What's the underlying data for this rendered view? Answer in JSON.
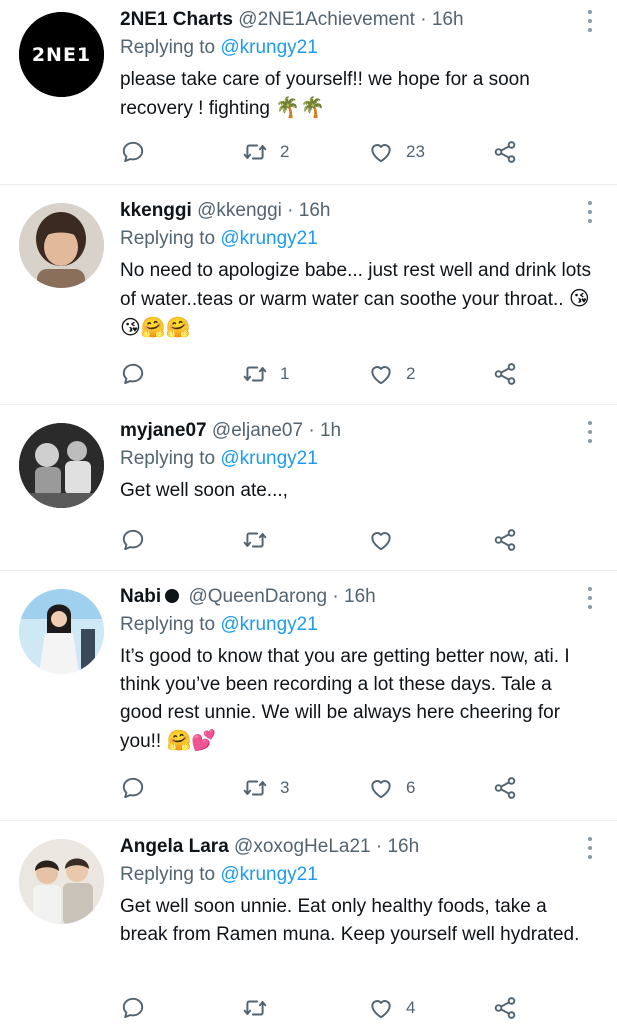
{
  "tweets": [
    {
      "name": "2NE1 Charts",
      "handle": "@2NE1Achievement",
      "time": "16h",
      "replying_label": "Replying to",
      "replying_to": "@krungy21",
      "text": "please take care of yourself!! we hope for a soon recovery ! fighting",
      "emoji": "🌴🌴",
      "retweets": "2",
      "likes": "23",
      "avatar_text": "2NE1"
    },
    {
      "name": "kkenggi",
      "handle": "@kkenggi",
      "time": "16h",
      "replying_label": "Replying to",
      "replying_to": "@krungy21",
      "text": "No need to apologize babe... just rest well and drink lots of water..teas or warm water can soothe your throat..",
      "emoji": "😘😘🤗🤗",
      "retweets": "1",
      "likes": "2"
    },
    {
      "name": "myjane07",
      "handle": "@eljane07",
      "time": "1h",
      "replying_label": "Replying to",
      "replying_to": "@krungy21",
      "text": "Get well soon ate...,",
      "emoji": "",
      "retweets": "",
      "likes": ""
    },
    {
      "name": "Nabi",
      "handle": "@QueenDarong",
      "time": "16h",
      "replying_label": "Replying to",
      "replying_to": "@krungy21",
      "text": "It’s good to know that you are getting better now, ati. I think you’ve been recording a lot these days. Tale a good rest unnie. We will be always here cheering for you!!",
      "emoji": "🤗💕",
      "retweets": "3",
      "likes": "6"
    },
    {
      "name": "Angela Lara",
      "handle": "@xoxogHeLa21",
      "time": "16h",
      "replying_label": "Replying to",
      "replying_to": "@krungy21",
      "text": "Get well soon unnie. Eat only healthy foods, take a break from Ramen muna. Keep yourself well hydrated.",
      "emoji": "",
      "retweets": "",
      "likes": "4"
    }
  ],
  "separator": "·",
  "icons": [
    "reply-icon",
    "retweet-icon",
    "like-icon",
    "share-icon",
    "more-icon"
  ],
  "colors": {
    "link": "#1d9bf0",
    "muted": "#536471",
    "text": "#0f1419",
    "divider": "#e6ecf0"
  }
}
